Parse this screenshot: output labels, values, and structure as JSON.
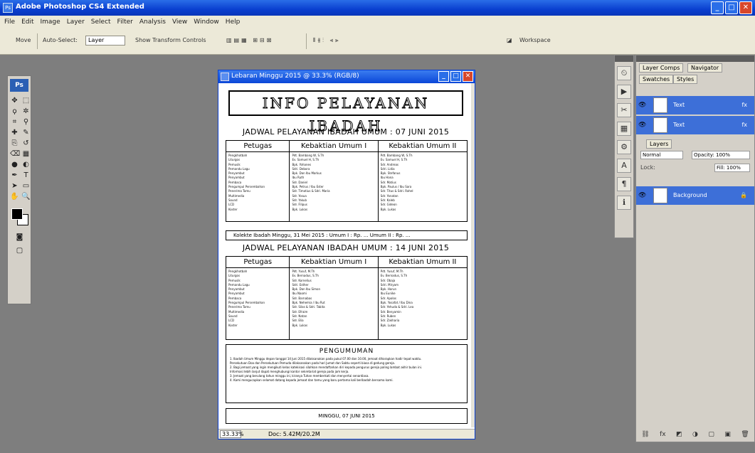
{
  "app": {
    "title": "Adobe Photoshop CS4 Extended",
    "window_buttons": [
      "_",
      "□",
      "✕"
    ]
  },
  "menu": [
    "File",
    "Edit",
    "Image",
    "Layer",
    "Select",
    "Filter",
    "Analysis",
    "View",
    "Window",
    "Help"
  ],
  "options_bar": {
    "tool_label": "Move",
    "auto_select_label": "Auto-Select:",
    "auto_select_value": "Layer",
    "transform_label": "Show Transform Controls",
    "workspace_label": "Workspace"
  },
  "tools": {
    "logo": "Ps",
    "icons": [
      "move-icon",
      "marquee-icon",
      "lasso-icon",
      "magic-wand-icon",
      "crop-icon",
      "eyedropper-icon",
      "healing-icon",
      "brush-icon",
      "stamp-icon",
      "history-brush-icon",
      "eraser-icon",
      "gradient-icon",
      "blur-icon",
      "dodge-icon",
      "pen-icon",
      "type-icon",
      "path-select-icon",
      "shape-icon",
      "hand-icon",
      "zoom-icon"
    ],
    "glyphs": [
      "✥",
      "⬚",
      "ϙ",
      "✲",
      "⌗",
      "⚲",
      "✚",
      "✎",
      "⎘",
      "↺",
      "⌫",
      "▦",
      "●",
      "◐",
      "✒",
      "T",
      "➤",
      "▭",
      "✋",
      "🔍"
    ],
    "bottom_glyphs": [
      "◙",
      "▢"
    ]
  },
  "document": {
    "title": "Lebaran Minggu 2015 @ 33.3% (RGB/8)",
    "zoom": "33.33%",
    "status": "Doc: 5.42M/20.2M",
    "banner": "INFO PELAYANAN IBADAH",
    "schedule1": {
      "title": "JADWAL PELAYANAN IBADAH UMUM : 07 JUNI 2015",
      "headers": [
        "Petugas",
        "Kebaktian Umum I",
        "Kebaktian Umum II"
      ],
      "col1": [
        "Pengkhotbah",
        "Liturgos",
        "Pemusik",
        "Pemandu Lagu",
        "Penyambut",
        "Penyambut",
        "Pembaca",
        "Pengumpul Persembahan",
        "Penerima Tamu",
        "Multimedia",
        "Sound",
        "LCD",
        "Koster"
      ],
      "col2": [
        "Pdt. Bambang W, S.Th",
        "Ev. Samuel H, S.Th",
        "Bpk. Yohanes",
        "Sdri. Debora",
        "Bpk. Dan Ibu Markus",
        "Ibu Ruth",
        "Sdr. Daniel",
        "Bpk. Petrus / Ibu Ester",
        "Sdr. Timotius & Sdri. Maria",
        "Sdr. Yosua",
        "Sdr. Yakub",
        "Sdr. Filipus",
        "Bpk. Lukas"
      ],
      "col3": [
        "Pdt. Bambang W, S.Th",
        "Ev. Samuel H, S.Th",
        "Sdr. Andreas",
        "Sdri. Lidia",
        "Bpk. Stefanus",
        "Ibu Hana",
        "Sdr. Matius",
        "Bpk. Paulus / Ibu Sara",
        "Sdr. Titus & Sdri. Rahel",
        "Sdr. Yonatan",
        "Sdr. Kaleb",
        "Sdr. Gideon",
        "Bpk. Lukas"
      ]
    },
    "collecte": "Kolekte Ibadah Minggu, 31 Mei 2015 : Umum I : Rp.   ...   Umum II : Rp.   ...",
    "schedule2": {
      "title": "JADWAL PELAYANAN IBADAH UMUM : 14 JUNI 2015",
      "headers": [
        "Petugas",
        "Kebaktian Umum I",
        "Kebaktian Umum II"
      ],
      "col1": [
        "Pengkhotbah",
        "Liturgos",
        "Pemusik",
        "Pemandu Lagu",
        "Penyambut",
        "Penyambut",
        "Pembaca",
        "Pengumpul Persembahan",
        "Penerima Tamu",
        "Multimedia",
        "Sound",
        "LCD",
        "Koster"
      ],
      "col2": [
        "Pdt. Yusuf, M.Th",
        "Ev. Bernadus, S.Th",
        "Sdr. Kornelius",
        "Sdri. Esther",
        "Bpk. Dan Ibu Simon",
        "Ibu Naomi",
        "Sdr. Barnabas",
        "Bpk. Nehemia / Ibu Rut",
        "Sdr. Silas & Sdri. Tabita",
        "Sdr. Efraim",
        "Sdr. Natan",
        "Sdr. Elia",
        "Bpk. Lukas"
      ],
      "col3": [
        "Pdt. Yusuf, M.Th",
        "Ev. Bernadus, S.Th",
        "Sdr. Obaja",
        "Sdri. Miryam",
        "Bpk. Harun",
        "Ibu Eunike",
        "Sdr. Apolos",
        "Bpk. Yosafat / Ibu Dina",
        "Sdr. Yehuda & Sdri. Lea",
        "Sdr. Benyamin",
        "Sdr. Ruben",
        "Sdr. Zakharia",
        "Bpk. Lukas"
      ]
    },
    "info": {
      "head": "PENGUMUMAN",
      "lines": [
        "1. Ibadah Umum Minggu depan tanggal 14 Juni 2015 dilaksanakan pada pukul 07.00 dan 10.00, jemaat diharapkan hadir tepat waktu.",
        "   Persekutuan Doa dan Persekutuan Pemuda dilaksanakan pada hari Jumat dan Sabtu seperti biasa di gedung gereja.",
        "2. Bagi jemaat yang ingin mengikuti kelas katekisasi silahkan mendaftarkan diri kepada pengurus gereja paling lambat akhir bulan ini.",
        "   Informasi lebih lanjut dapat menghubungi kantor sekretariat gereja pada jam kerja.",
        "3. Jemaat yang berulang tahun minggu ini, kiranya Tuhan memberkati dan menyertai senantiasa.",
        "4. Kami mengucapkan selamat datang kepada jemaat dan tamu yang baru pertama kali beribadah bersama kami."
      ]
    },
    "footer": "MINGGU, 07 JUNI 2015"
  },
  "panels": {
    "tabs_top": [
      "Layer Comps",
      "Navigator"
    ],
    "tabs_mid": [
      "Swatches",
      "Styles"
    ],
    "layers_top": [
      {
        "name": "Text",
        "right": "fx"
      },
      {
        "name": "Text",
        "right": "fx"
      }
    ],
    "layers_tab": "Layers",
    "blend_mode": "Normal",
    "opacity_label": "Opacity: 100%",
    "lock_label": "Lock:",
    "fill_label": "Fill: 100%",
    "background_layer": "Background",
    "dock_icons": [
      "history-icon",
      "actions-icon",
      "tools-preset-icon",
      "brushes-icon",
      "clone-source-icon",
      "character-icon",
      "paragraph-icon",
      "info-icon"
    ],
    "dock_glyphs": [
      "⏲",
      "▶",
      "✂",
      "▦",
      "⚙",
      "A",
      "¶",
      "ℹ"
    ],
    "bottom_glyphs": [
      "⛓",
      "fx",
      "◩",
      "◑",
      "▢",
      "▣",
      "🗑"
    ]
  }
}
